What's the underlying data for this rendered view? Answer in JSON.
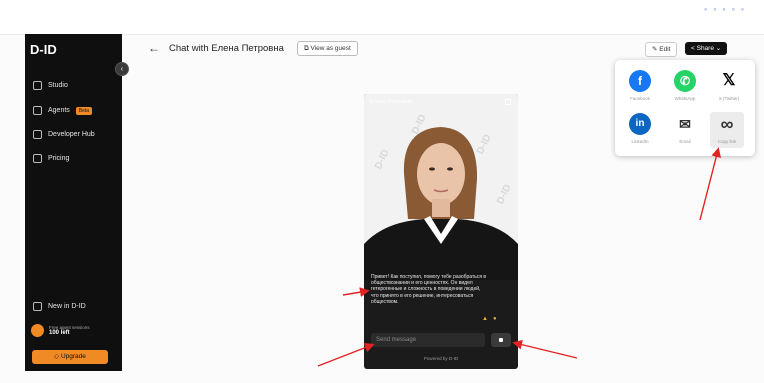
{
  "brand": {
    "logo": "D-ID"
  },
  "sidebar": {
    "items": [
      {
        "label": "Studio",
        "icon": "studio-icon"
      },
      {
        "label": "Agents",
        "badge": "Beta",
        "icon": "agents-icon"
      },
      {
        "label": "Developer Hub",
        "icon": "developer-hub-icon"
      },
      {
        "label": "Pricing",
        "icon": "pricing-icon"
      }
    ],
    "new_label": "New in D-ID",
    "account": {
      "line1": "Free agent sessions",
      "line2": "100 left"
    },
    "upgrade_label": "Upgrade"
  },
  "header": {
    "back_icon": "←",
    "title": "Chat with Елена Петровна",
    "view_as_guest": "View as guest",
    "edit_label": "Edit",
    "share_label": "Share"
  },
  "share_popup": {
    "options": [
      {
        "label": "Facebook",
        "glyph": "f",
        "color": "#1877f2"
      },
      {
        "label": "WhatsApp",
        "glyph": "✆",
        "color": "#25d366"
      },
      {
        "label": "X (Twitter)",
        "glyph": "𝕏",
        "color": "#000000"
      },
      {
        "label": "LinkedIn",
        "glyph": "in",
        "color": "#0a66c2"
      },
      {
        "label": "Email",
        "glyph": "✉",
        "color": "#333333"
      },
      {
        "label": "Copy link",
        "glyph": "∞",
        "color": "#333333"
      }
    ]
  },
  "chat": {
    "agent_name": "Елена Петровна",
    "watermark": "D-ID",
    "message": "Привет! Как поступил, помогу тебе разобраться в обществознании и его ценностях. Он видел гетерогенные и сложность в поведении людей, что принято в его решение, интересоваться обществом.",
    "input_placeholder": "Send message",
    "powered_by": "Powered by D-ID"
  },
  "colors": {
    "accent": "#f08a24",
    "annotation_arrow": "#e02424",
    "sidebar_bg": "#0f0f0f"
  }
}
